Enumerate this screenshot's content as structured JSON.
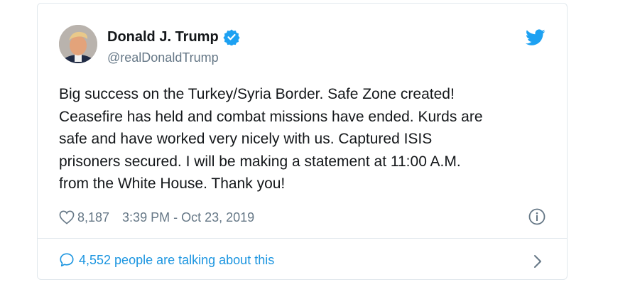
{
  "author": {
    "display_name": "Donald J. Trump",
    "handle": "@realDonaldTrump",
    "verified": true,
    "avatar_icon": "profile-photo"
  },
  "tweet": {
    "text": "Big success on the Turkey/Syria Border. Safe Zone created!\nCeasefire has held and combat missions have ended. Kurds are\nsafe and have worked very nicely with us. Captured ISIS\nprisoners secured. I will be making a statement at 11:00 A.M.\nfrom the White House. Thank you!",
    "like_count": "8,187",
    "timestamp": "3:39 PM - Oct 23, 2019"
  },
  "footer": {
    "talking_text": "4,552 people are talking about this"
  },
  "icons": {
    "brand": "twitter-bird-icon",
    "verified": "verified-badge-icon",
    "like": "heart-icon",
    "info": "info-icon",
    "reply": "speech-bubble-icon",
    "chevron": "chevron-right-icon"
  },
  "colors": {
    "brand_blue": "#1da1f2",
    "link_blue": "#1b95e0",
    "text_primary": "#14171a",
    "text_secondary": "#657786",
    "border": "#e1e8ed"
  }
}
